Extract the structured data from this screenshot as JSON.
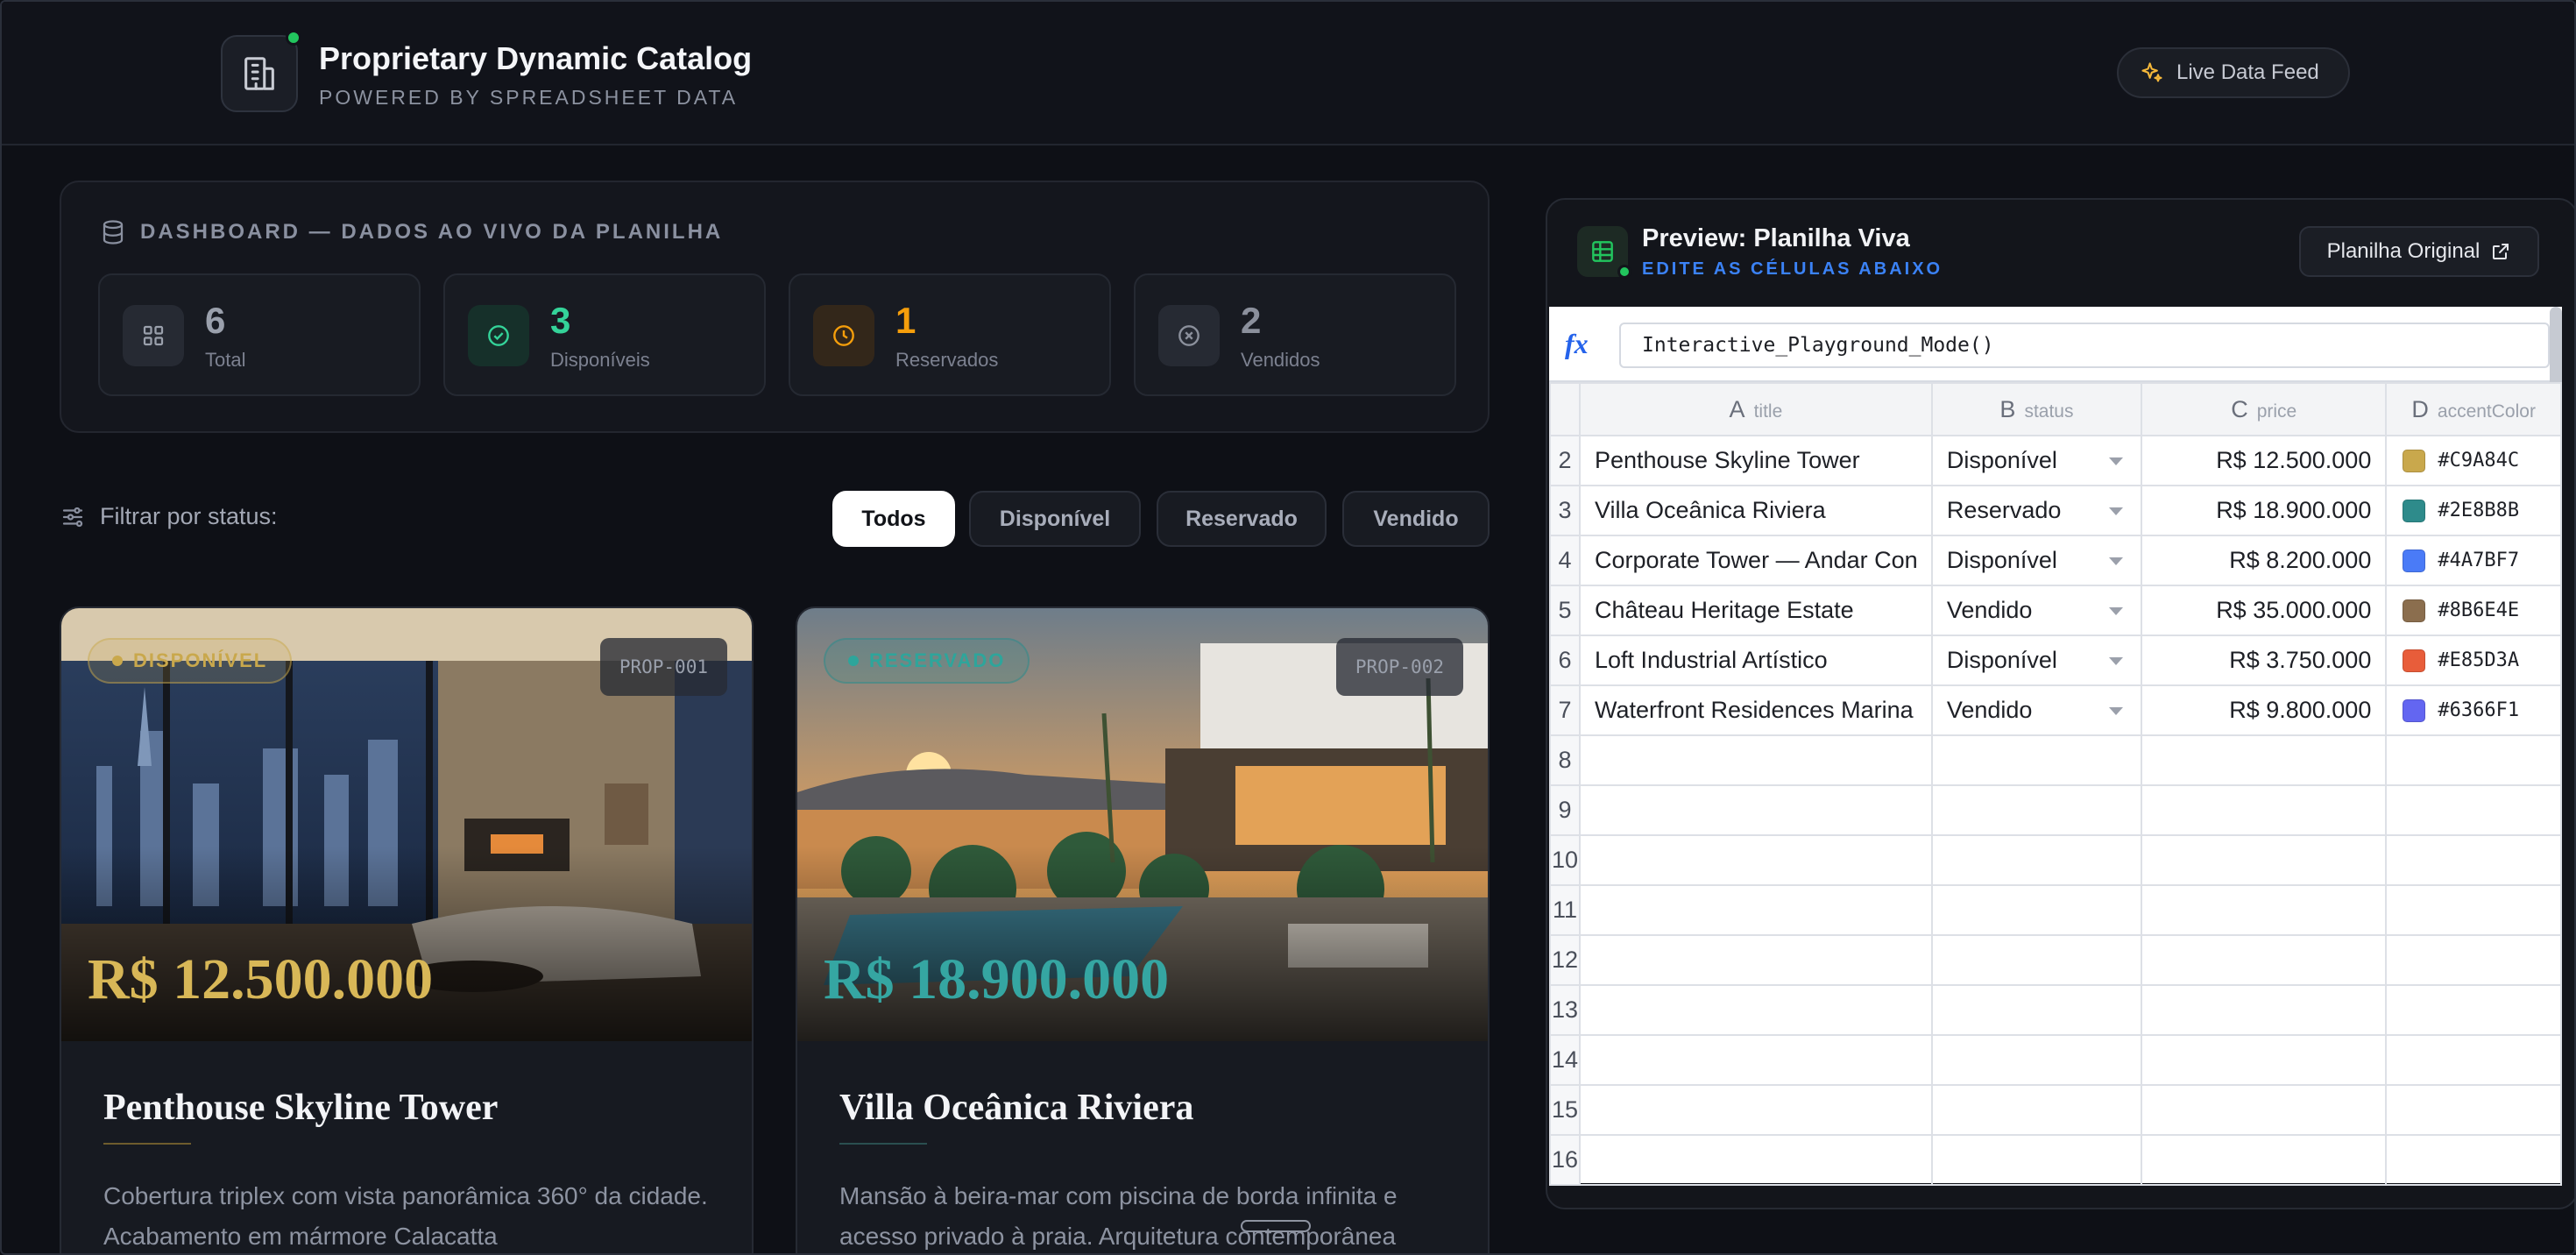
{
  "header": {
    "title": "Proprietary Dynamic Catalog",
    "subtitle": "POWERED BY SPREADSHEET DATA",
    "live_feed_label": "Live Data Feed"
  },
  "dashboard": {
    "title": "DASHBOARD — DADOS AO VIVO DA PLANILHA",
    "stats": [
      {
        "value": "6",
        "label": "Total",
        "color": "#9aa0ac"
      },
      {
        "value": "3",
        "label": "Disponíveis",
        "color": "#34d399"
      },
      {
        "value": "1",
        "label": "Reservados",
        "color": "#f59e0b"
      },
      {
        "value": "2",
        "label": "Vendidos",
        "color": "#8b909c"
      }
    ]
  },
  "filter": {
    "label": "Filtrar por status:",
    "options": [
      "Todos",
      "Disponível",
      "Reservado",
      "Vendido"
    ],
    "active": "Todos"
  },
  "properties": [
    {
      "badge": "DISPONÍVEL",
      "id": "PROP-001",
      "price": "R$ 12.500.000",
      "title": "Penthouse Skyline Tower",
      "description": "Cobertura triplex com vista panorâmica 360° da cidade. Acabamento em mármore Calacatta",
      "accent": "#C9A84C"
    },
    {
      "badge": "RESERVADO",
      "id": "PROP-002",
      "price": "R$ 18.900.000",
      "title": "Villa Oceânica Riviera",
      "description": "Mansão à beira-mar com piscina de borda infinita e acesso privado à praia. Arquitetura contemporânea",
      "accent": "#2E8B8B"
    }
  ],
  "sheet": {
    "title": "Preview: Planilha Viva",
    "subtitle": "EDITE AS CÉLULAS ABAIXO",
    "original_button": "Planilha Original",
    "formula": "Interactive_Playground_Mode()",
    "columns": [
      {
        "letter": "A",
        "name": "title"
      },
      {
        "letter": "B",
        "name": "status"
      },
      {
        "letter": "C",
        "name": "price"
      },
      {
        "letter": "D",
        "name": "accentColor"
      }
    ],
    "rows": [
      {
        "n": "2",
        "title": "Penthouse Skyline Tower",
        "status": "Disponível",
        "price": "R$ 12.500.000",
        "color": "#C9A84C"
      },
      {
        "n": "3",
        "title": "Villa Oceânica Riviera",
        "status": "Reservado",
        "price": "R$ 18.900.000",
        "color": "#2E8B8B"
      },
      {
        "n": "4",
        "title": "Corporate Tower — Andar Con",
        "status": "Disponível",
        "price": "R$ 8.200.000",
        "color": "#4A7BF7"
      },
      {
        "n": "5",
        "title": "Château Heritage Estate",
        "status": "Vendido",
        "price": "R$ 35.000.000",
        "color": "#8B6E4E"
      },
      {
        "n": "6",
        "title": "Loft Industrial Artístico",
        "status": "Disponível",
        "price": "R$ 3.750.000",
        "color": "#E85D3A"
      },
      {
        "n": "7",
        "title": "Waterfront Residences Marina",
        "status": "Vendido",
        "price": "R$ 9.800.000",
        "color": "#6366F1"
      }
    ],
    "empty_rows": [
      "8",
      "9",
      "10",
      "11",
      "12",
      "13",
      "14",
      "15",
      "16"
    ]
  }
}
